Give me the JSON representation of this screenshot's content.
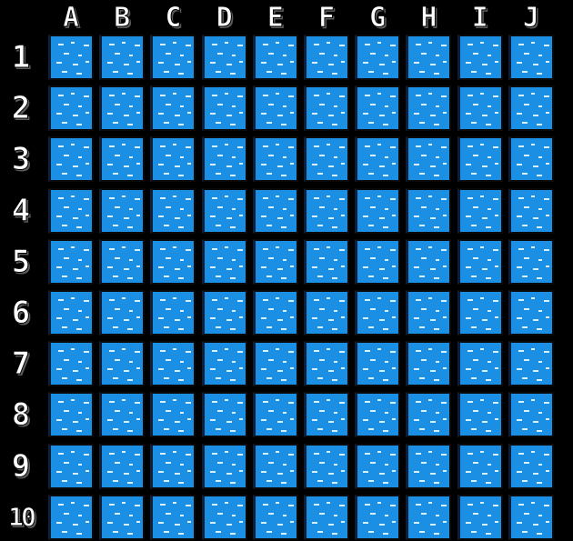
{
  "columns": [
    "A",
    "B",
    "C",
    "D",
    "E",
    "F",
    "G",
    "H",
    "I",
    "J"
  ],
  "rows": [
    "1",
    "2",
    "3",
    "4",
    "5",
    "6",
    "7",
    "8",
    "9",
    "10"
  ],
  "colors": {
    "background": "#000000",
    "water": "#1a8fe3",
    "wave": "#d9f1ff",
    "label": "#ffffff"
  },
  "cell_state": "water"
}
